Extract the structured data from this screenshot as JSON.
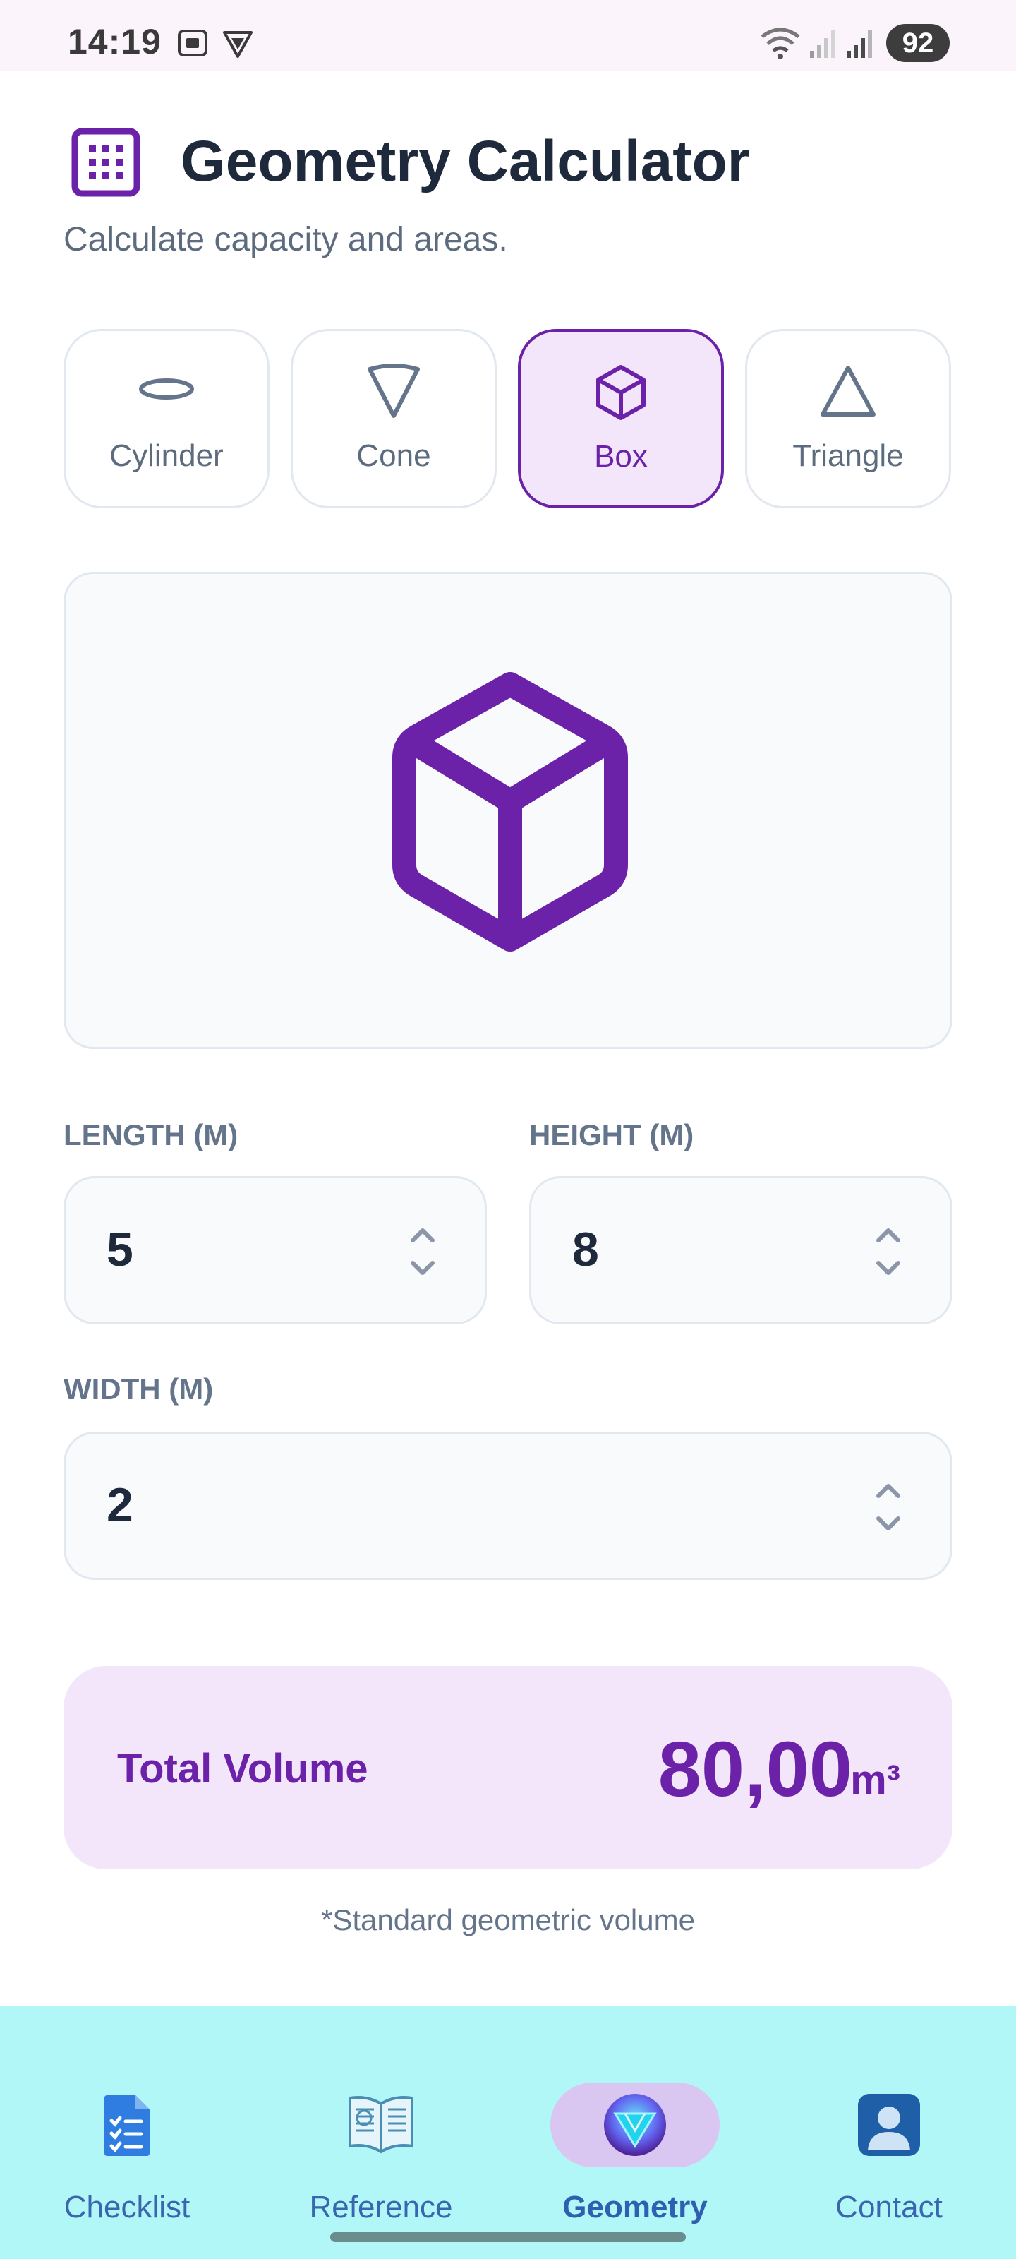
{
  "status_bar": {
    "time": "14:19",
    "battery": "92",
    "icons": [
      "screenshot-icon",
      "vpn-icon",
      "wifi-icon",
      "signal-icon",
      "signal-icon"
    ]
  },
  "header": {
    "title": "Geometry Calculator",
    "subtitle": "Calculate capacity and areas.",
    "icon": "calculator-icon"
  },
  "shapes": [
    {
      "label": "Cylinder",
      "icon": "cylinder-icon",
      "selected": false
    },
    {
      "label": "Cone",
      "icon": "cone-icon",
      "selected": false
    },
    {
      "label": "Box",
      "icon": "cube-icon",
      "selected": true
    },
    {
      "label": "Triangle",
      "icon": "triangle-icon",
      "selected": false
    }
  ],
  "inputs": {
    "length": {
      "label": "LENGTH (M)",
      "value": "5"
    },
    "height": {
      "label": "HEIGHT (M)",
      "value": "8"
    },
    "width": {
      "label": "WIDTH (M)",
      "value": "2"
    }
  },
  "result": {
    "label": "Total Volume",
    "value": "80,00",
    "unit": "m³",
    "note": "*Standard geometric volume"
  },
  "nav": {
    "items": [
      {
        "label": "Checklist",
        "icon": "checklist-icon",
        "active": false
      },
      {
        "label": "Reference",
        "icon": "book-icon",
        "active": false
      },
      {
        "label": "Geometry",
        "icon": "geometry-icon",
        "active": true
      },
      {
        "label": "Contact",
        "icon": "contact-icon",
        "active": false
      }
    ]
  },
  "colors": {
    "accent": "#6b21a8",
    "accent_bg": "#f3e6fb",
    "nav_bg": "#b2f7f7",
    "nav_text": "#3a66b0"
  }
}
